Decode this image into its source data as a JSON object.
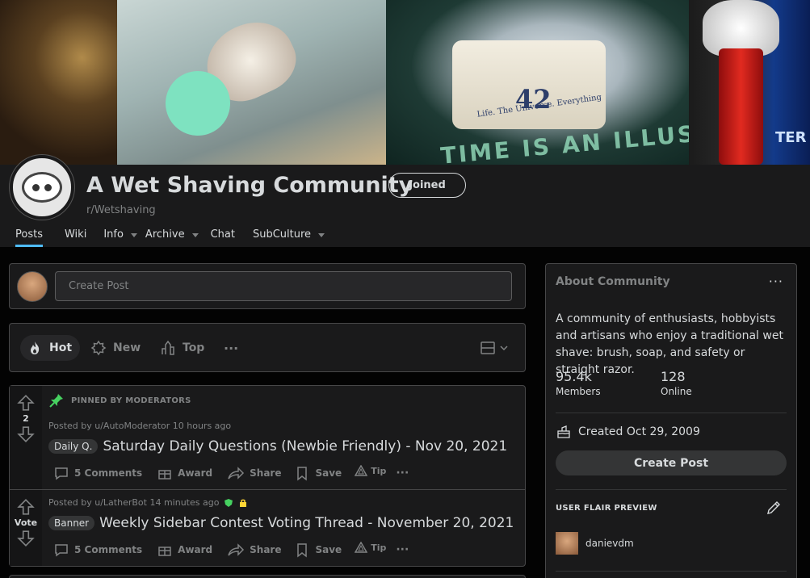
{
  "banner": {
    "tin_number": "42",
    "tin_text": "Life. The Universe. Everything",
    "illusion_text": "TIME IS AN ILLUSION",
    "terra_text": "TER"
  },
  "community": {
    "title": "A Wet Shaving Community",
    "subreddit": "r/Wetshaving",
    "joined_label": "Joined"
  },
  "nav": {
    "items": [
      {
        "label": "Posts",
        "active": true,
        "dropdown": false
      },
      {
        "label": "Wiki",
        "active": false,
        "dropdown": false
      },
      {
        "label": "Info",
        "active": false,
        "dropdown": true
      },
      {
        "label": "Archive",
        "active": false,
        "dropdown": true
      },
      {
        "label": "Chat",
        "active": false,
        "dropdown": false
      },
      {
        "label": "SubCulture",
        "active": false,
        "dropdown": true
      }
    ]
  },
  "create_post": {
    "placeholder": "Create Post"
  },
  "sort": {
    "hot": "Hot",
    "new": "New",
    "top": "Top",
    "more": "···"
  },
  "posts": [
    {
      "pinned_label": "PINNED BY MODERATORS",
      "vote_count": "2",
      "posted_by": "Posted by u/AutoModerator 10 hours ago",
      "flair": "Daily Q.",
      "title": "Saturday Daily Questions (Newbie Friendly) - Nov 20, 2021",
      "comments": "5 Comments",
      "award": "Award",
      "share": "Share",
      "save": "Save",
      "tip": "Tip"
    },
    {
      "vote_count": "Vote",
      "posted_by": "Posted by u/LatherBot 14 minutes ago",
      "flair": "Banner",
      "title": "Weekly Sidebar Contest Voting Thread - November 20, 2021",
      "comments": "5 Comments",
      "award": "Award",
      "share": "Share",
      "save": "Save",
      "tip": "Tip"
    }
  ],
  "about": {
    "header": "About Community",
    "description": "A community of enthusiasts, hobbyists and artisans who enjoy a traditional wet shave: brush, soap, and safety or straight razor.",
    "members_count": "95.4k",
    "members_label": "Members",
    "online_count": "128",
    "online_label": "Online",
    "created": "Created Oct 29, 2009",
    "create_post_label": "Create Post",
    "flair_preview_label": "USER FLAIR PREVIEW",
    "username": "danievdm"
  },
  "colors": {
    "accent": "#4fbcff",
    "card_bg": "#1a1a1b",
    "page_bg": "#030303",
    "pin_green": "#46d160"
  }
}
